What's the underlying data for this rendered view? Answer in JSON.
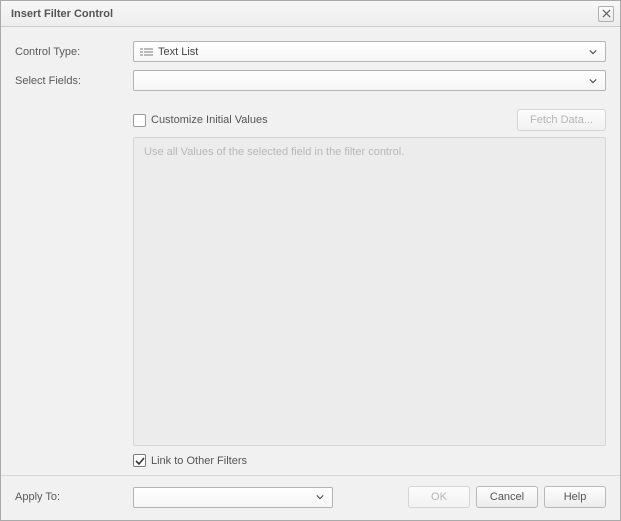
{
  "dialog": {
    "title": "Insert Filter Control"
  },
  "labels": {
    "control_type": "Control Type:",
    "select_fields": "Select Fields:",
    "apply_to": "Apply To:"
  },
  "control_type": {
    "selected": "Text List",
    "icon": "text-list-icon"
  },
  "select_fields": {
    "selected": ""
  },
  "customize": {
    "checked": false,
    "label": "Customize Initial Values"
  },
  "fetch_button": {
    "label": "Fetch Data...",
    "disabled": true
  },
  "values_placeholder": "Use all Values of the selected field in the filter control.",
  "link_filters": {
    "checked": true,
    "label": "Link to Other Filters"
  },
  "apply_to": {
    "selected": ""
  },
  "buttons": {
    "ok": "OK",
    "cancel": "Cancel",
    "help": "Help",
    "ok_disabled": true
  }
}
